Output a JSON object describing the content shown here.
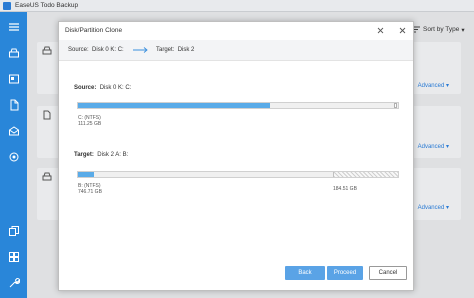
{
  "app": {
    "title": "EaseUS Todo Backup"
  },
  "toolbar": {
    "sort_label": "Sort by Type"
  },
  "cards": [
    {
      "advanced_label": "Advanced"
    },
    {
      "advanced_label": "Advanced"
    },
    {
      "advanced_label": "Advanced"
    }
  ],
  "dialog": {
    "title": "Disk/Partition Clone",
    "summary": {
      "source_label": "Source:",
      "source_value": "Disk 0 K: C:",
      "target_label": "Target:",
      "target_value": "Disk 2"
    },
    "source": {
      "label": "Source:",
      "disk": "Disk 0 K: C:",
      "used_fraction": 0.6,
      "partition_name": "C: (NTFS)",
      "partition_size": "111.25 GB"
    },
    "target": {
      "label": "Target:",
      "disk": "Disk 2 A: B:",
      "used_fraction": 0.05,
      "partition_name": "B: (NTFS)",
      "partition_size": "746.71 GB",
      "unallocated_size": "184.51 GB"
    },
    "buttons": {
      "back": "Back",
      "proceed": "Proceed",
      "cancel": "Cancel"
    }
  },
  "colors": {
    "sidebar": "#2986d9",
    "accent": "#5aa3e6",
    "disk_fill": "#5aabe8"
  },
  "icons": {
    "sidebar": [
      "menu-icon",
      "disk-backup-icon",
      "system-backup-icon",
      "file-backup-icon",
      "mail-backup-icon",
      "smart-backup-icon",
      "clone-icon",
      "tools-icon",
      "settings-icon"
    ]
  }
}
